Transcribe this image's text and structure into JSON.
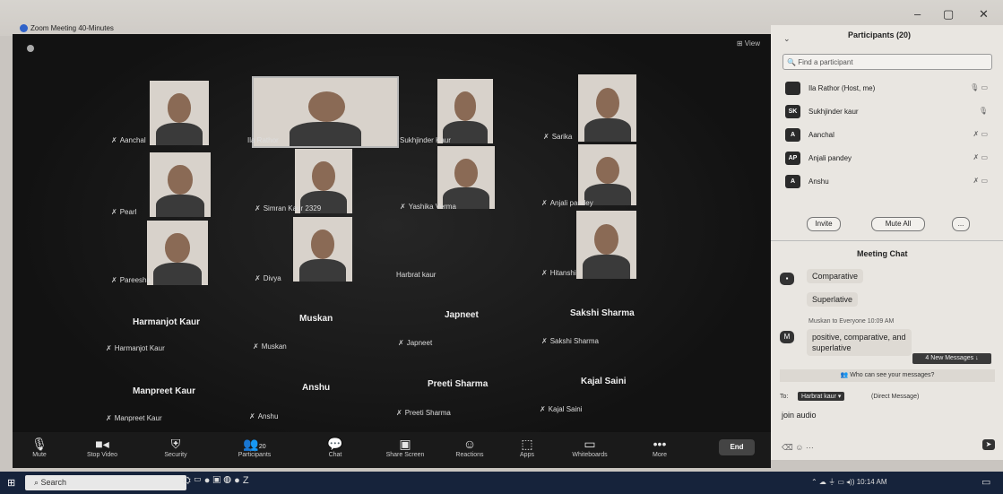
{
  "window": {
    "title": "Zoom Meeting 40-Minutes",
    "controls": [
      "–",
      "▢",
      "✕"
    ]
  },
  "meeting": {
    "view_label": "View",
    "video_tiles": [
      {
        "name": "Aanchal"
      },
      {
        "name": "Ila Rathor"
      },
      {
        "name": "Sukhjinder Kaur"
      },
      {
        "name": "Sarika"
      },
      {
        "name": "Pearl"
      },
      {
        "name": "Simran Kaur 2329"
      },
      {
        "name": "Yashika Verma"
      },
      {
        "name": "Anjali pandey"
      },
      {
        "name": "Pareesha"
      },
      {
        "name": "Divya"
      },
      {
        "name": "Hitanshi"
      }
    ],
    "name_only_tiles": [
      {
        "big": "",
        "small": "Harbrat kaur"
      },
      {
        "big": "Harmanjot Kaur",
        "small": "Harmanjot Kaur"
      },
      {
        "big": "Muskan",
        "small": "Muskan"
      },
      {
        "big": "Japneet",
        "small": "Japneet"
      },
      {
        "big": "Sakshi Sharma",
        "small": "Sakshi Sharma"
      },
      {
        "big": "Manpreet Kaur",
        "small": "Manpreet Kaur"
      },
      {
        "big": "Anshu",
        "small": "Anshu"
      },
      {
        "big": "Preeti Sharma",
        "small": "Preeti Sharma"
      },
      {
        "big": "Kajal Saini",
        "small": "Kajal Saini"
      }
    ]
  },
  "toolbar": {
    "mute": "Mute",
    "stop_video": "Stop Video",
    "security": "Security",
    "participants": "Participants",
    "participants_count": "20",
    "chat": "Chat",
    "share_screen": "Share Screen",
    "reactions": "Reactions",
    "apps": "Apps",
    "whiteboards": "Whiteboards",
    "more": "More",
    "end": "End"
  },
  "participants_panel": {
    "title": "Participants (20)",
    "search_placeholder": "Find a participant",
    "rows": [
      {
        "initials": "",
        "name": "Ila Rathor (Host, me)"
      },
      {
        "initials": "SK",
        "name": "Sukhjinder kaur"
      },
      {
        "initials": "A",
        "name": "Aanchal"
      },
      {
        "initials": "AP",
        "name": "Anjali pandey"
      },
      {
        "initials": "A",
        "name": "Anshu"
      }
    ],
    "invite": "Invite",
    "mute_all": "Mute All",
    "more": "..."
  },
  "chat_panel": {
    "title": "Meeting Chat",
    "messages": [
      {
        "text": "Comparative"
      },
      {
        "text": "Superlative"
      }
    ],
    "sender_line": "Muskan to Everyone 10:09 AM",
    "sender_initial": "M",
    "last_message_line1": "positive, comparative, and",
    "last_message_line2": "superlative",
    "new_messages": "4 New Messages",
    "who_can_see": "Who can see your messages?",
    "to_label": "To:",
    "recipient": "Harbrat kaur",
    "direct_message": "(Direct Message)",
    "draft": "join audio"
  },
  "taskbar": {
    "search": "Search",
    "clock": "10:14 AM"
  }
}
